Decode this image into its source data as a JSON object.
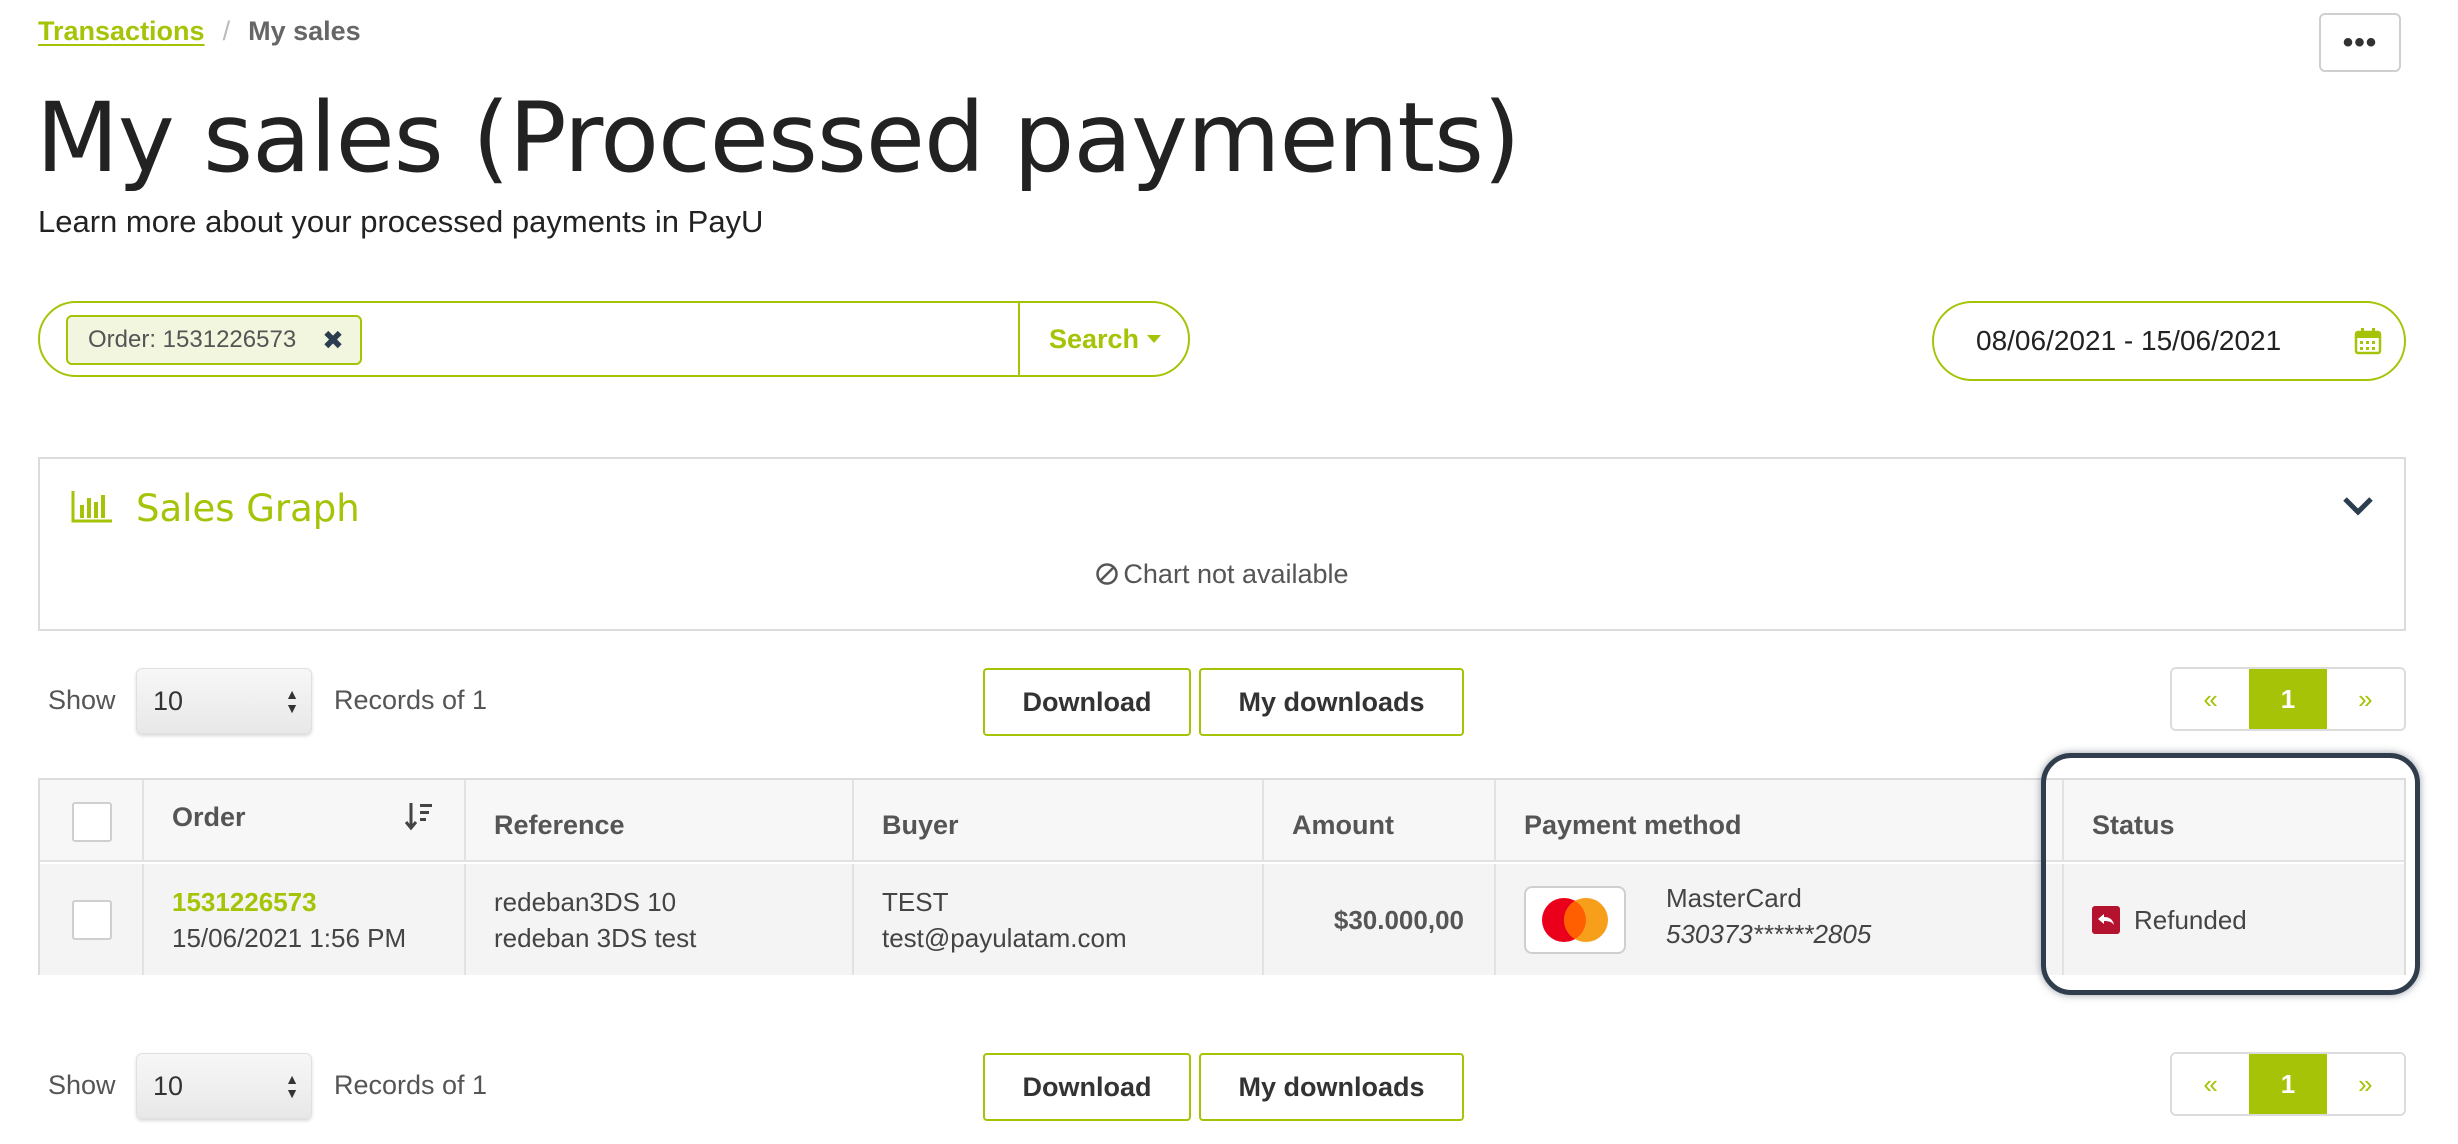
{
  "breadcrumb": {
    "parent": "Transactions",
    "separator": "/",
    "current": "My sales"
  },
  "header": {
    "more_label": "•••",
    "title": "My sales (Processed payments)",
    "subtitle": "Learn more about your processed payments in PayU"
  },
  "search": {
    "chip_label": "Order: 1531226573",
    "chip_remove": "✖",
    "button_label": "Search"
  },
  "date_range": {
    "value": "08/06/2021 - 15/06/2021"
  },
  "sales_graph": {
    "title": "Sales Graph",
    "empty_message": "Chart not available"
  },
  "controls": {
    "show_label": "Show",
    "page_size": "10",
    "records_label": "Records of 1",
    "download_label": "Download",
    "my_downloads_label": "My downloads",
    "pager": {
      "prev": "«",
      "current": "1",
      "next": "»"
    }
  },
  "table": {
    "columns": [
      "Order",
      "Reference",
      "Buyer",
      "Amount",
      "Payment method",
      "Status"
    ],
    "rows": [
      {
        "order_id": "1531226573",
        "order_date": "15/06/2021 1:56 PM",
        "reference_1": "redeban3DS 10",
        "reference_2": "redeban 3DS test",
        "buyer_name": "TEST",
        "buyer_email": "test@payulatam.com",
        "amount": "$30.000,00",
        "payment_method": "MasterCard",
        "card_number": "530373******2805",
        "status": "Refunded"
      }
    ]
  },
  "colors": {
    "accent": "#a6c307",
    "status_refunded": "#b5122f",
    "highlight_border": "#2f3d4c"
  },
  "icons": {
    "more": "ellipsis-icon",
    "remove_chip": "close-icon",
    "calendar": "calendar-icon",
    "graph": "bar-chart-icon",
    "toggle": "chevron-down-icon",
    "unavailable": "ban-icon",
    "sort": "sort-desc-icon",
    "status": "refund-icon",
    "card": "mastercard-logo-icon"
  }
}
